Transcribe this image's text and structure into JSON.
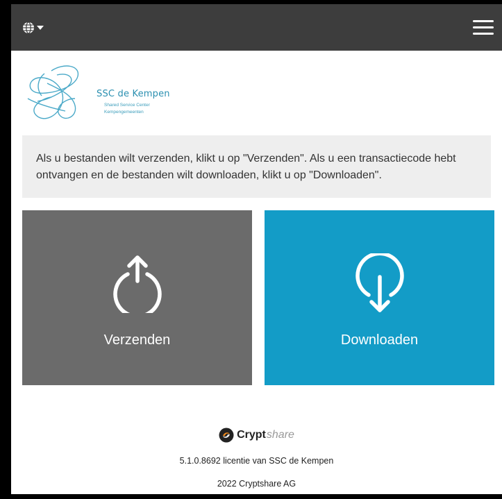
{
  "navbar": {
    "language_icon": "globe-icon",
    "dropdown_icon": "caret-down-icon",
    "menu_icon": "hamburger-menu-icon",
    "background": "#3d3d3d"
  },
  "logo": {
    "name": "SSC de Kempen",
    "subtitle_1": "Shared Service Center",
    "subtitle_2": "Kempengemeenten",
    "color": "#2a8fb0"
  },
  "info": {
    "text": "Als u bestanden wilt verzenden, klikt u op \"Verzenden\". Als u een transactiecode hebt ontvangen en de bestanden wilt downloaden, klikt u op \"Downloaden\"."
  },
  "tiles": {
    "send": {
      "label": "Verzenden",
      "icon": "upload-icon",
      "color": "#6b6b6b"
    },
    "download": {
      "label": "Downloaden",
      "icon": "download-icon",
      "color": "#139cc7"
    }
  },
  "footer": {
    "brand_strong": "Crypt",
    "brand_light": "share",
    "version": "5.1.0.8692 licentie van SSC de Kempen",
    "copyright": "2022 Cryptshare AG"
  }
}
